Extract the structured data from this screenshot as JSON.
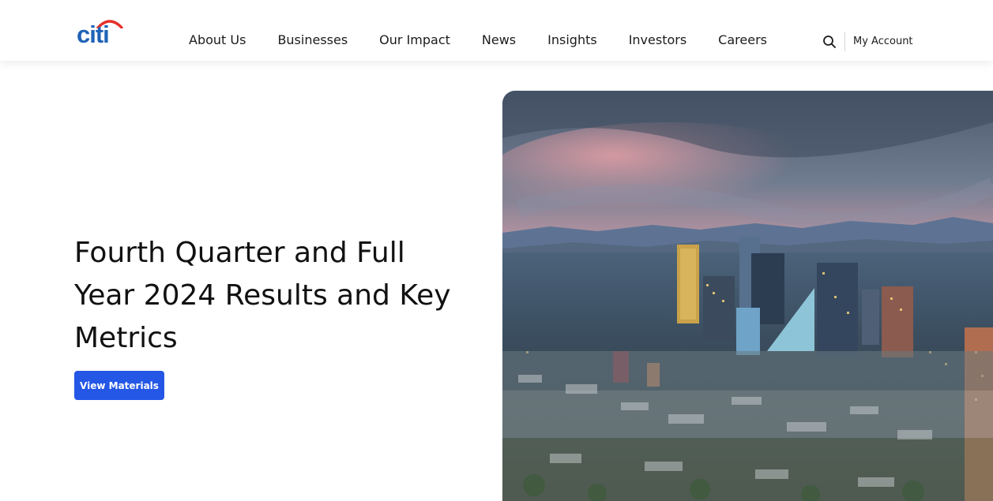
{
  "brand": {
    "logo_text": "citi",
    "arc_color": "#e4312a",
    "text_color": "#1f63b7"
  },
  "nav": {
    "items": [
      {
        "label": "About Us"
      },
      {
        "label": "Businesses"
      },
      {
        "label": "Our Impact"
      },
      {
        "label": "News"
      },
      {
        "label": "Insights"
      },
      {
        "label": "Investors"
      },
      {
        "label": "Careers"
      }
    ]
  },
  "header": {
    "account_label": "My Account",
    "search_icon": "search-icon"
  },
  "hero": {
    "title": "Fourth Quarter and Full Year 2024 Results and Key Metrics",
    "cta_label": "View Materials",
    "cta_color": "#2457e6",
    "image": "city-skyline-photo"
  }
}
